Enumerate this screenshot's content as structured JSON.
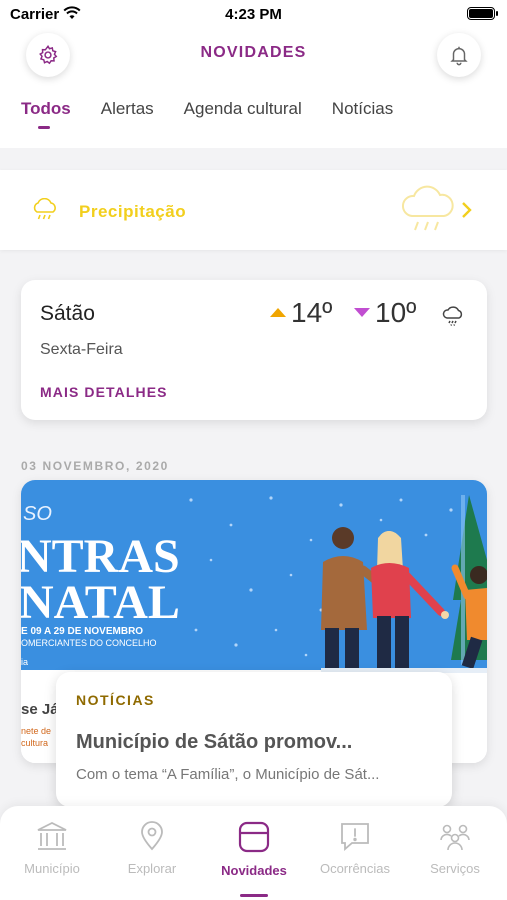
{
  "status_bar": {
    "carrier": "Carrier",
    "time": "4:23 PM"
  },
  "header": {
    "title": "NOVIDADES",
    "settings_icon": "gear-icon",
    "notifications_icon": "bell-icon"
  },
  "tabs": [
    {
      "label": "Todos",
      "active": true
    },
    {
      "label": "Alertas",
      "active": false
    },
    {
      "label": "Agenda cultural",
      "active": false
    },
    {
      "label": "Notícias",
      "active": false
    }
  ],
  "precipitation": {
    "label": "Precipitação",
    "icon": "rain-cloud-icon",
    "color": "#f2cf1d"
  },
  "weather": {
    "city": "Sátão",
    "weekday": "Sexta-Feira",
    "max_temp": "14º",
    "min_temp": "10º",
    "details_label": "MAIS DETALHES",
    "icon": "rain-cloud-icon"
  },
  "news": {
    "date": "03 NOVEMBRO, 2020",
    "image_text": {
      "line_so": "SO",
      "line_ntras": "NTRAS",
      "line_natal": "NATAL",
      "dates": "E 09 A 29 DE NOVEMBRO",
      "merchants": "OMERCIANTES DO CONCELHO",
      "ja": "se Já!",
      "small1": "nete de",
      "small2": "cultura",
      "ia": "ia"
    },
    "category": "NOTÍCIAS",
    "title": "Município de Sátão promov...",
    "excerpt": "Com o tema “A Família”, o Município de Sát..."
  },
  "bottom_nav": [
    {
      "label": "Município",
      "icon": "building-icon",
      "active": false
    },
    {
      "label": "Explorar",
      "icon": "map-pin-icon",
      "active": false
    },
    {
      "label": "Novidades",
      "icon": "calendar-icon",
      "active": true
    },
    {
      "label": "Ocorrências",
      "icon": "alert-message-icon",
      "active": false
    },
    {
      "label": "Serviços",
      "icon": "people-icon",
      "active": false
    }
  ],
  "colors": {
    "accent": "#8b2a86",
    "warm_up": "#f0a500",
    "cool_down": "#c14ed1",
    "banner_blue": "#3a8fe0"
  }
}
